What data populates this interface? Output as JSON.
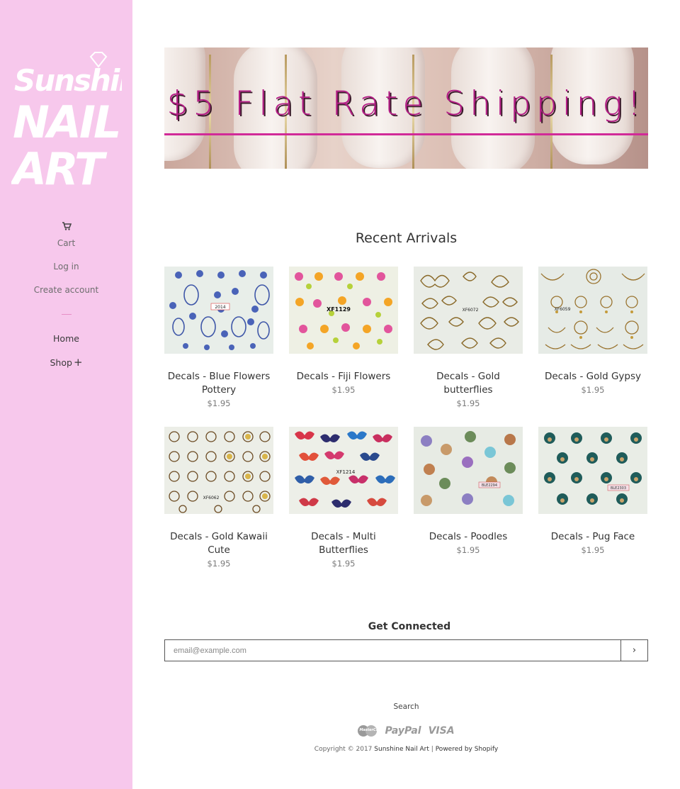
{
  "sidebar": {
    "logo_alt": "Sunshine NAIL ART",
    "cart_label": "Cart",
    "login_label": "Log in",
    "create_account_label": "Create account",
    "home_label": "Home",
    "shop_label": "Shop",
    "shop_expand": "+"
  },
  "banner": {
    "text": "$5 Flat Rate Shipping!"
  },
  "recent": {
    "title": "Recent Arrivals",
    "products": [
      {
        "name": "Decals - Blue Flowers Pottery",
        "price": "$1.95",
        "code": "2014"
      },
      {
        "name": "Decals - Fiji Flowers",
        "price": "$1.95",
        "code": "XF1129"
      },
      {
        "name": "Decals - Gold butterflies",
        "price": "$1.95",
        "code": "XF6072"
      },
      {
        "name": "Decals - Gold Gypsy",
        "price": "$1.95",
        "code": "XF6059"
      },
      {
        "name": "Decals - Gold Kawaii Cute",
        "price": "$1.95",
        "code": "XF6062"
      },
      {
        "name": "Decals - Multi Butterflies",
        "price": "$1.95",
        "code": "XF1214"
      },
      {
        "name": "Decals - Poodles",
        "price": "$1.95",
        "code": "BLE2294"
      },
      {
        "name": "Decals - Pug Face",
        "price": "$1.95",
        "code": "BLE2303"
      }
    ]
  },
  "newsletter": {
    "title": "Get Connected",
    "placeholder": "email@example.com",
    "submit": "›"
  },
  "footer": {
    "search_label": "Search",
    "payments": {
      "mastercard": "MasterCard",
      "paypal": "PayPal",
      "visa": "VISA"
    },
    "copyright_prefix": "Copyright © 2017",
    "store_name": "Sunshine Nail Art",
    "separator": "|",
    "powered_by": "Powered by Shopify"
  },
  "colors": {
    "sidebar_bg": "#f7c8ec",
    "banner_text": "#b41e86",
    "banner_line": "#d12a98"
  }
}
